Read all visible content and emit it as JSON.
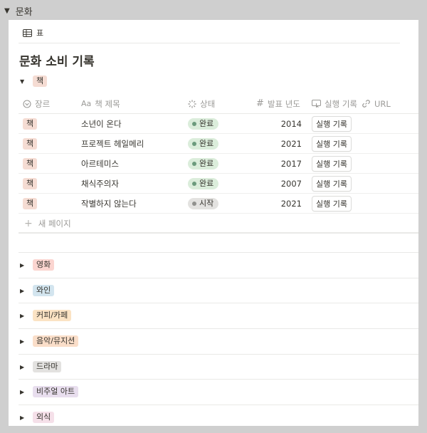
{
  "page": {
    "toggle_title": "문화"
  },
  "view": {
    "tab_label": "표"
  },
  "database": {
    "title": "문화 소비 기록"
  },
  "open_group": {
    "label": "책",
    "color": "#f5dcd3"
  },
  "columns": [
    {
      "label": "장르",
      "icon": "select-icon"
    },
    {
      "label": "책 제목",
      "icon": "title-text-icon"
    },
    {
      "label": "상태",
      "icon": "status-icon"
    },
    {
      "label": "발표 년도",
      "icon": "number-icon"
    },
    {
      "label": "실행 기록",
      "icon": "button-icon"
    },
    {
      "label": "URL",
      "icon": "link-icon"
    }
  ],
  "rows": [
    {
      "genre": "책",
      "title": "소년이 온다",
      "status": "완료",
      "year": "2014",
      "action": "실행 기록"
    },
    {
      "genre": "책",
      "title": "프로젝트 헤일메리",
      "status": "완료",
      "year": "2021",
      "action": "실행 기록"
    },
    {
      "genre": "책",
      "title": "아르테미스",
      "status": "완료",
      "year": "2017",
      "action": "실행 기록"
    },
    {
      "genre": "책",
      "title": "채식주의자",
      "status": "완료",
      "year": "2007",
      "action": "실행 기록"
    },
    {
      "genre": "책",
      "title": "작별하지 않는다",
      "status": "시작",
      "year": "2021",
      "action": "실행 기록"
    }
  ],
  "status_styles": {
    "완료": {
      "bg": "#dbeddb",
      "dot": "#6c9b7d"
    },
    "시작": {
      "bg": "#e3e2e0",
      "dot": "#91918e"
    }
  },
  "new_page_label": "새 페이지",
  "collapsed_groups": [
    {
      "label": "영화",
      "color": "#fbd5d0"
    },
    {
      "label": "와인",
      "color": "#d3e5ef"
    },
    {
      "label": "커피/카페",
      "color": "#fbe3c4"
    },
    {
      "label": "음악/뮤지션",
      "color": "#fadec9"
    },
    {
      "label": "드라마",
      "color": "#e3e2e0"
    },
    {
      "label": "비주얼 아트",
      "color": "#e8deee"
    },
    {
      "label": "외식",
      "color": "#f5e0e9"
    }
  ]
}
